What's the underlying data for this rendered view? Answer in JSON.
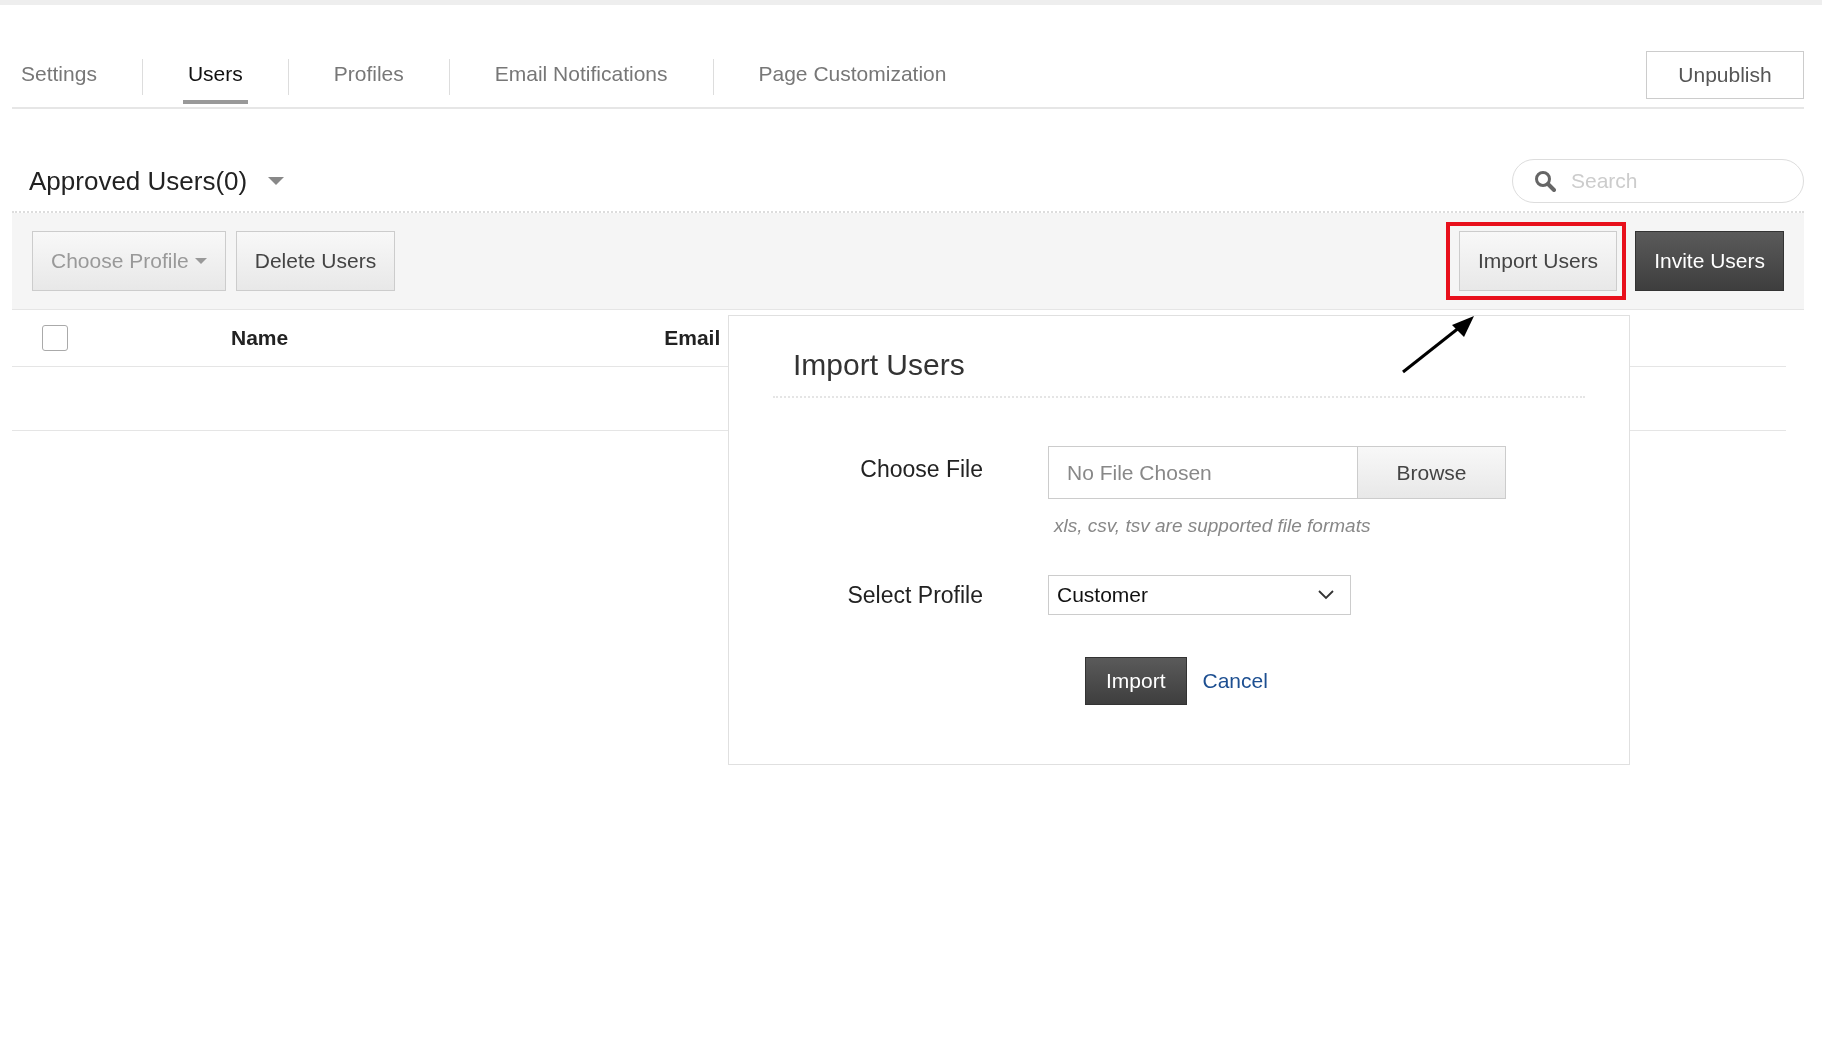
{
  "tabs": [
    {
      "label": "Settings",
      "selected": false
    },
    {
      "label": "Users",
      "selected": true
    },
    {
      "label": "Profiles",
      "selected": false
    },
    {
      "label": "Email Notifications",
      "selected": false
    },
    {
      "label": "Page Customization",
      "selected": false
    }
  ],
  "unpublish_button": "Unpublish",
  "section": {
    "title": "Approved Users(0)",
    "search": {
      "placeholder": "Search"
    }
  },
  "toolbar": {
    "choose_profile": {
      "label": "Choose Profile",
      "disabled": true
    },
    "delete_users": "Delete Users",
    "import_users": {
      "label": "Import Users",
      "highlighted": true
    },
    "invite_users": "Invite Users"
  },
  "table": {
    "select_all_checked": false,
    "columns": [
      "Name",
      "Email"
    ]
  },
  "dialog": {
    "title": "Import Users",
    "file_label": "Choose File",
    "file_placeholder": "No File Chosen",
    "browse_button": "Browse",
    "hint": "xls, csv, tsv are supported file formats",
    "profile_label": "Select Profile",
    "profile_value": "Customer",
    "import_button": "Import",
    "cancel_link": "Cancel"
  }
}
